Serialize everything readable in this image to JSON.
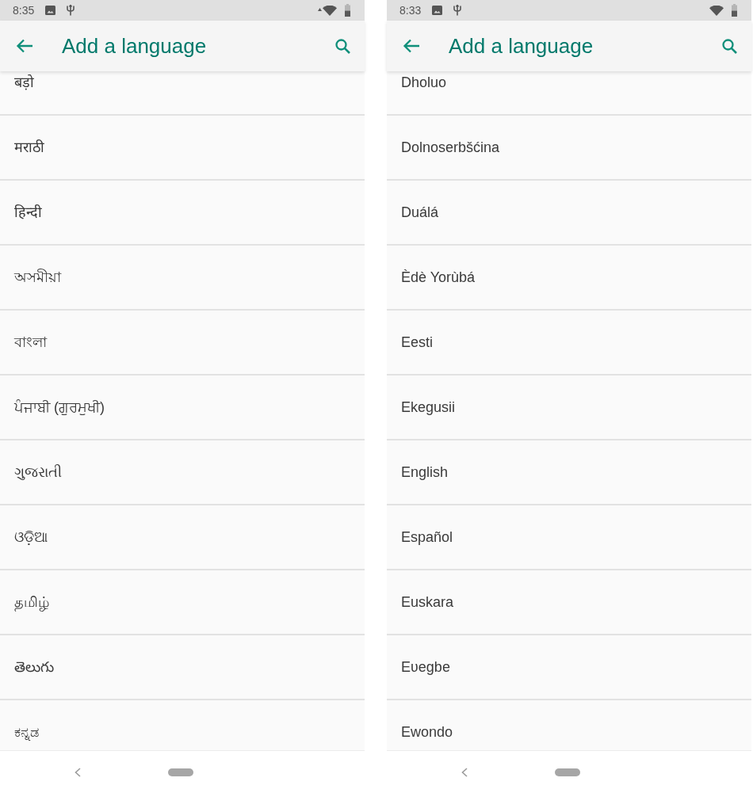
{
  "screens": [
    {
      "status_bar": {
        "time": "8:35",
        "wifi_activity": true
      },
      "app_bar": {
        "title": "Add a language"
      },
      "languages": [
        "बड़ो",
        "मराठी",
        "हिन्दी",
        "অসমীয়া",
        "বাংলা",
        "ਪੰਜਾਬੀ (ਗੁਰਮੁਖੀ)",
        "ગુજરાતી",
        "ଓଡ଼ିଆ",
        "தமிழ்",
        "తెలుగు",
        "ಕನ್ನಡ"
      ]
    },
    {
      "status_bar": {
        "time": "8:33",
        "wifi_activity": false
      },
      "app_bar": {
        "title": "Add a language"
      },
      "languages": [
        "Dholuo",
        "Dolnoserbšćina",
        "Duálá",
        "Èdè Yorùbá",
        "Eesti",
        "Ekegusii",
        "English",
        "Español",
        "Euskara",
        "Eʋegbe",
        "Ewondo"
      ]
    }
  ]
}
